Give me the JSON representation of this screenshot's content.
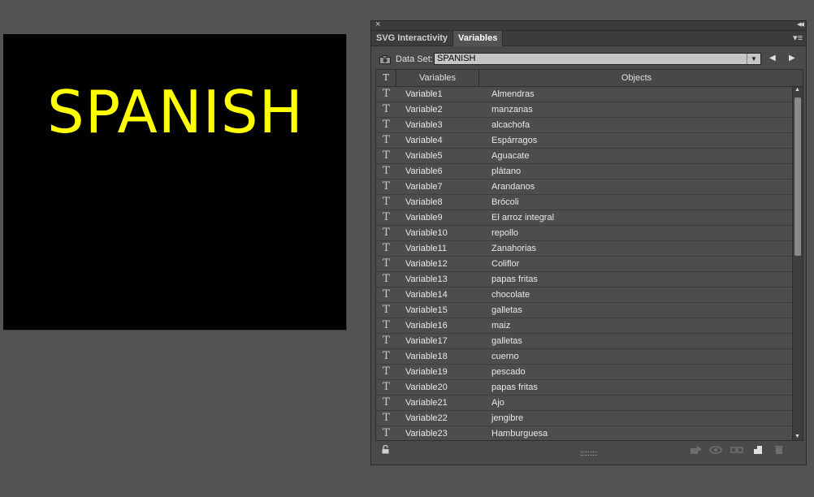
{
  "artboard": {
    "text": "SPANISH",
    "text_color": "#ffff00",
    "background": "#000000"
  },
  "panel": {
    "close_glyph": "×",
    "collapse_glyph": "◂◂",
    "menu_glyph": "▾≡",
    "tabs": [
      {
        "label": "SVG Interactivity"
      },
      {
        "label": "Variables"
      }
    ],
    "active_tab": "Variables",
    "dataset": {
      "label": "Data Set:",
      "value": "SPANISH",
      "dropdown_glyph": "▼",
      "prev_glyph": "◀",
      "next_glyph": "▶"
    },
    "table": {
      "headers": {
        "type": "T",
        "variables": "Variables",
        "objects": "Objects"
      },
      "type_glyph": "T",
      "rows": [
        {
          "variable": "Variable1",
          "object": "Almendras"
        },
        {
          "variable": "Variable2",
          "object": "manzanas"
        },
        {
          "variable": "Variable3",
          "object": "alcachofa"
        },
        {
          "variable": "Variable4",
          "object": "Espárragos"
        },
        {
          "variable": "Variable5",
          "object": "Aguacate"
        },
        {
          "variable": "Variable6",
          "object": "plátano"
        },
        {
          "variable": "Variable7",
          "object": "Arandanos"
        },
        {
          "variable": "Variable8",
          "object": "Brócoli"
        },
        {
          "variable": "Variable9",
          "object": "El arroz integral"
        },
        {
          "variable": "Variable10",
          "object": "repollo"
        },
        {
          "variable": "Variable11",
          "object": "Zanahorias"
        },
        {
          "variable": "Variable12",
          "object": "Coliflor"
        },
        {
          "variable": "Variable13",
          "object": "papas fritas"
        },
        {
          "variable": "Variable14",
          "object": "chocolate"
        },
        {
          "variable": "Variable15",
          "object": "galletas"
        },
        {
          "variable": "Variable16",
          "object": "maiz"
        },
        {
          "variable": "Variable17",
          "object": "galletas"
        },
        {
          "variable": "Variable18",
          "object": "cuerno"
        },
        {
          "variable": "Variable19",
          "object": "pescado"
        },
        {
          "variable": "Variable20",
          "object": "papas fritas"
        },
        {
          "variable": "Variable21",
          "object": "Ajo"
        },
        {
          "variable": "Variable22",
          "object": "jengibre"
        },
        {
          "variable": "Variable23",
          "object": "Hamburguesa"
        }
      ]
    },
    "footer_icons": [
      "lock-icon",
      "make-object-dynamic-icon",
      "make-visibility-dynamic-icon",
      "unbind-icon",
      "new-variable-icon",
      "delete-variable-icon"
    ]
  }
}
